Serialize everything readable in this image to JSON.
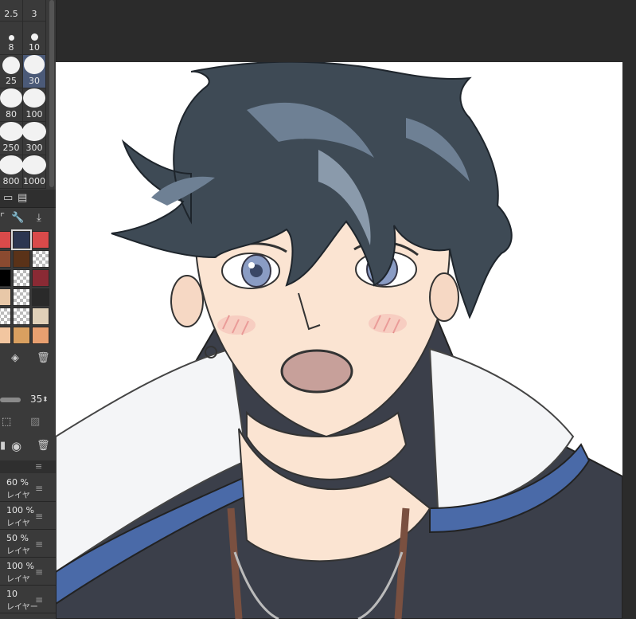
{
  "brush_sizes": [
    {
      "label": "2.5",
      "selected": false
    },
    {
      "label": "3",
      "selected": false
    },
    {
      "label": "8",
      "selected": false
    },
    {
      "label": "10",
      "selected": false
    },
    {
      "label": "25",
      "selected": false
    },
    {
      "label": "30",
      "selected": true
    },
    {
      "label": "80",
      "selected": false
    },
    {
      "label": "100",
      "selected": false
    },
    {
      "label": "250",
      "selected": false
    },
    {
      "label": "300",
      "selected": false
    },
    {
      "label": "800",
      "selected": false
    },
    {
      "label": "1000",
      "selected": false
    }
  ],
  "palette": {
    "swatches": [
      "#d94a4a",
      "#2c3650",
      "#d94a4a",
      "#8a4a30",
      "#5a3218",
      "checker",
      "#000000",
      "checker",
      "#8a2a34",
      "#e8c8a8",
      "checker",
      "#2a2a2a",
      "checker",
      "checker",
      "#e0d0b8",
      "#f2c6a0",
      "#d9a060",
      "#e8a070"
    ]
  },
  "brush_opacity": {
    "value": "35"
  },
  "layers": [
    {
      "pct": "60 %",
      "name": "レイヤ"
    },
    {
      "pct": "100 %",
      "name": "レイヤ"
    },
    {
      "pct": "50 %",
      "name": "レイヤ"
    },
    {
      "pct": "100 %",
      "name": "レイヤ"
    },
    {
      "pct": "10",
      "name": "レイヤー"
    }
  ],
  "colors": {
    "hair": "#3e4a55",
    "skin": "#fbe4d2",
    "jacket": "#3b3f4a",
    "jacket_trim": "#4a6aa8",
    "collar": "#ffffff",
    "eyes": "#8a9cc4"
  }
}
